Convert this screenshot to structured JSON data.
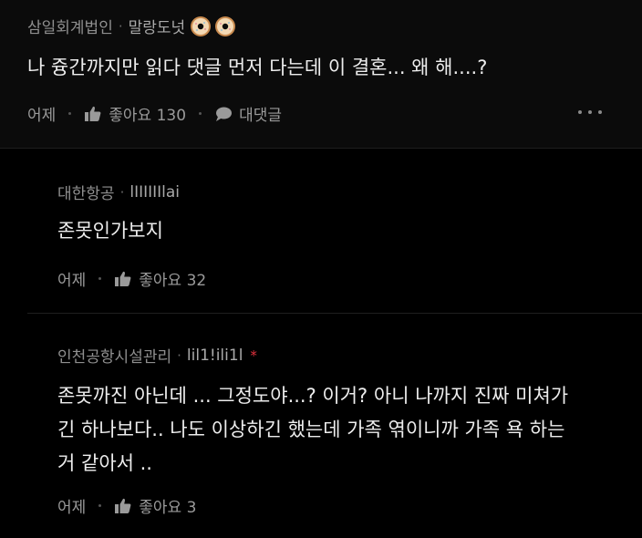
{
  "top_comment": {
    "company": "삼일회계법인",
    "separator": "·",
    "nickname": "말랑도넛",
    "badges": [
      "donut-icon",
      "donut-icon"
    ],
    "text": "나 즁간까지만 읽다 댓글 먼저 다는데 이 결혼... 왜 해....?",
    "time": "어제",
    "like_label": "좋아요 130",
    "reply_label": "대댓글"
  },
  "replies": [
    {
      "company": "대한항공",
      "separator": "·",
      "nickname": "lIIIIIIlai",
      "lines": [
        "존못인가보지"
      ],
      "time": "어제",
      "like_label": "좋아요 32"
    },
    {
      "company": "인천공항시설관리",
      "separator": "·",
      "nickname": "lil1!ili1l",
      "author_mark": "*",
      "lines": [
        "존못까진 아닌데 ... 그정도야...? 이거? 아니 나까지 진짜 미쳐가",
        "긴 하나보다.. 나도 이상하긴 했는데 가족 엮이니까 가족 욕 하는",
        "거 같아서 .."
      ],
      "time": "어제",
      "like_label": "좋아요 3"
    }
  ],
  "colors": {
    "background": "#000000",
    "top_comment_bg": "#0b0b0b",
    "author_mark": "#e0313d"
  }
}
